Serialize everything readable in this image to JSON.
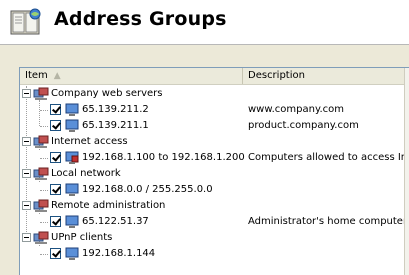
{
  "header": {
    "title": "Address Groups",
    "icon": "address-book-icon"
  },
  "list": {
    "columns": [
      {
        "label": "Item",
        "sort": "ascending"
      },
      {
        "label": "Description"
      }
    ],
    "groups": [
      {
        "label": "Company web servers",
        "children": [
          {
            "label": "65.139.211.2",
            "description": "www.company.com",
            "checked": true
          },
          {
            "label": "65.139.211.1",
            "description": "product.company.com",
            "checked": true
          }
        ]
      },
      {
        "label": "Internet access",
        "children": [
          {
            "label": "192.168.1.100 to 192.168.1.200",
            "description": "Computers allowed to access Internet",
            "checked": true
          }
        ]
      },
      {
        "label": "Local network",
        "children": [
          {
            "label": "192.168.0.0 / 255.255.0.0",
            "description": "",
            "checked": true
          }
        ]
      },
      {
        "label": "Remote administration",
        "children": [
          {
            "label": "65.122.51.37",
            "description": "Administrator's home computer",
            "checked": true
          }
        ]
      },
      {
        "label": "UPnP clients",
        "children": [
          {
            "label": "192.168.1.144",
            "description": "",
            "checked": true
          }
        ]
      }
    ]
  },
  "colors": {
    "panel": "#ece9d8",
    "list_border": "#7f9db9",
    "column_header": "#ebeadb"
  }
}
